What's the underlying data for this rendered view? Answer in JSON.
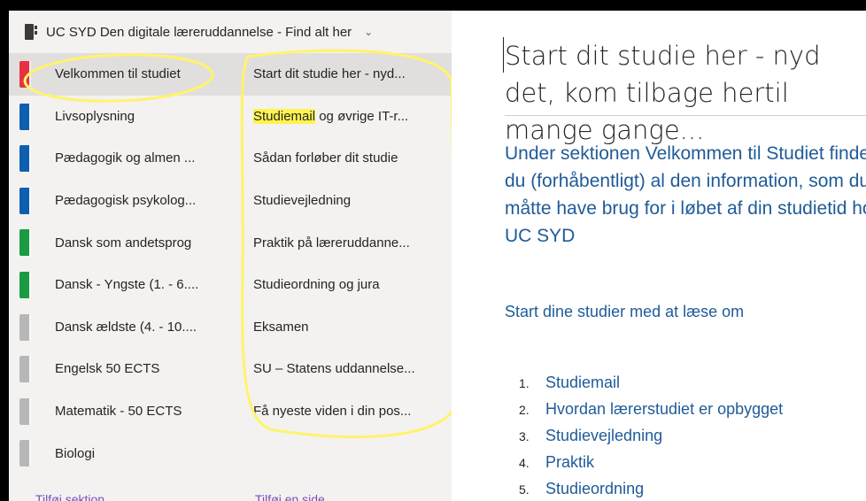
{
  "notebook": {
    "title": "UC SYD Den digitale læreruddannelse - Find alt her",
    "icon": "notebook-icon"
  },
  "sections": [
    {
      "label": "Velkommen til studiet",
      "color": "#e8313f",
      "selected": true
    },
    {
      "label": "Livsoplysning",
      "color": "#0f5fb0"
    },
    {
      "label": "Pædagogik og almen ...",
      "color": "#0f5fb0"
    },
    {
      "label": "Pædagogisk psykolog...",
      "color": "#0f5fb0"
    },
    {
      "label": "Dansk som andetsprog",
      "color": "#1a9a43"
    },
    {
      "label": "Dansk - Yngste (1. - 6....",
      "color": "#1a9a43"
    },
    {
      "label": "Dansk ældste (4. - 10....",
      "color": "#b7b7b7"
    },
    {
      "label": "Engelsk 50 ECTS",
      "color": "#b7b7b7"
    },
    {
      "label": "Matematik - 50 ECTS",
      "color": "#b7b7b7"
    },
    {
      "label": "Biologi",
      "color": "#b7b7b7"
    }
  ],
  "pages": [
    {
      "label": "Start dit studie her - nyd...",
      "selected": true
    },
    {
      "label_hl": "Studiemail",
      "label_rest": " og øvrige IT-r..."
    },
    {
      "label": "Sådan forløber dit studie"
    },
    {
      "label": "Studievejledning"
    },
    {
      "label": "Praktik på læreruddanne..."
    },
    {
      "label": "Studieordning og jura"
    },
    {
      "label": "Eksamen"
    },
    {
      "label": "SU – Statens uddannelse..."
    },
    {
      "label": "Få nyeste viden i din pos..."
    }
  ],
  "footer": {
    "add_section": "Tilføj sektion",
    "add_page": "Tilføj en side"
  },
  "content": {
    "title": "Start dit studie her - nyd det, kom tilbage hertil mange gange...",
    "intro": "Under sektionen Velkommen til Studiet finder du (forhåbentligt) al den information, som du måtte have brug for i løbet af din studietid hos UC SYD",
    "subhead": "Start dine studier med at læse om",
    "topics": [
      {
        "num": "1.",
        "label": "Studiemail"
      },
      {
        "num": "2.",
        "label": "Hvordan lærerstudiet er opbygget"
      },
      {
        "num": "3.",
        "label": "Studievejledning"
      },
      {
        "num": "4.",
        "label": "Praktik"
      },
      {
        "num": "5.",
        "label": "Studieordning"
      }
    ]
  },
  "colors": {
    "accent_blue": "#1f5b98",
    "highlight_yellow": "#fff44f",
    "link_purple": "#7a4dba",
    "annotation_yellow": "#fff46a"
  }
}
